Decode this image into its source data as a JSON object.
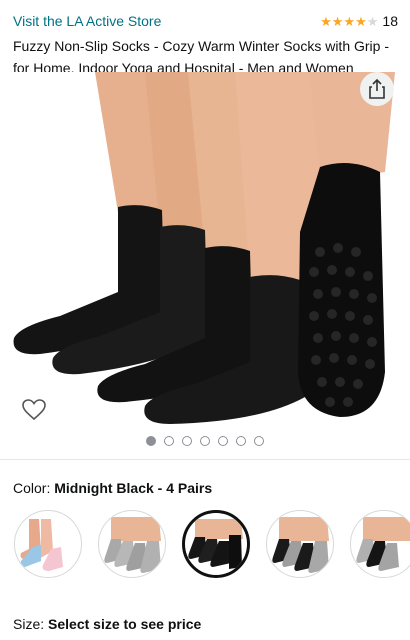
{
  "store": {
    "link_text": "Visit the LA Active Store"
  },
  "rating": {
    "stars": 4,
    "max": 5,
    "count": "18"
  },
  "product": {
    "title": "Fuzzy Non-Slip Socks - Cozy Warm Winter Socks with Grip - for Home, Indoor Yoga and Hospital - Men and Women"
  },
  "icons": {
    "share": "share-icon",
    "favorite": "heart-icon"
  },
  "carousel": {
    "count": 7,
    "active": 0
  },
  "color": {
    "label": "Color: ",
    "value": "Midnight Black - 4 Pairs"
  },
  "swatches": [
    {
      "name": "swatch-light-blue-pink"
    },
    {
      "name": "swatch-grey"
    },
    {
      "name": "swatch-midnight-black",
      "selected": true
    },
    {
      "name": "swatch-black-grey"
    },
    {
      "name": "swatch-grey-black"
    }
  ],
  "size": {
    "label": "Size: ",
    "value": "Select size to see price"
  },
  "colors": {
    "link": "#007185",
    "star": "#ffa41c",
    "text": "#0f1111"
  }
}
